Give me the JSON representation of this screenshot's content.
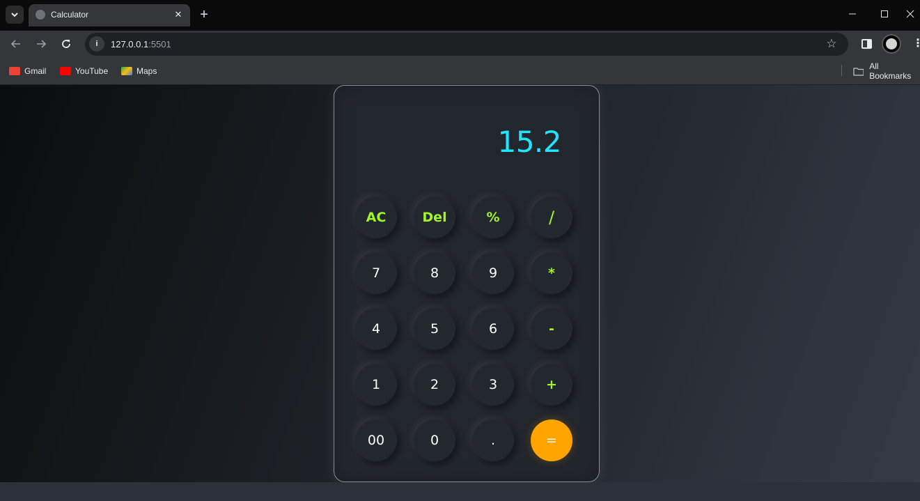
{
  "browser": {
    "tab_title": "Calculator",
    "url_host": "127.0.0.1",
    "url_port": ":5501",
    "bookmarks": [
      {
        "label": "Gmail",
        "color": "#ea4335"
      },
      {
        "label": "YouTube",
        "color": "#ff0000"
      },
      {
        "label": "Maps",
        "color": "#34a853"
      }
    ],
    "all_bookmarks_label": "All Bookmarks"
  },
  "calculator": {
    "display_value": "15.2",
    "accent_color": "#1fe6ff",
    "operator_color": "#a3f52b",
    "equals_color": "#ffa500",
    "keys": [
      [
        "AC",
        "Del",
        "%",
        "/"
      ],
      [
        "7",
        "8",
        "9",
        "*"
      ],
      [
        "4",
        "5",
        "6",
        "-"
      ],
      [
        "1",
        "2",
        "3",
        "+"
      ],
      [
        "00",
        "0",
        ".",
        "="
      ]
    ]
  }
}
